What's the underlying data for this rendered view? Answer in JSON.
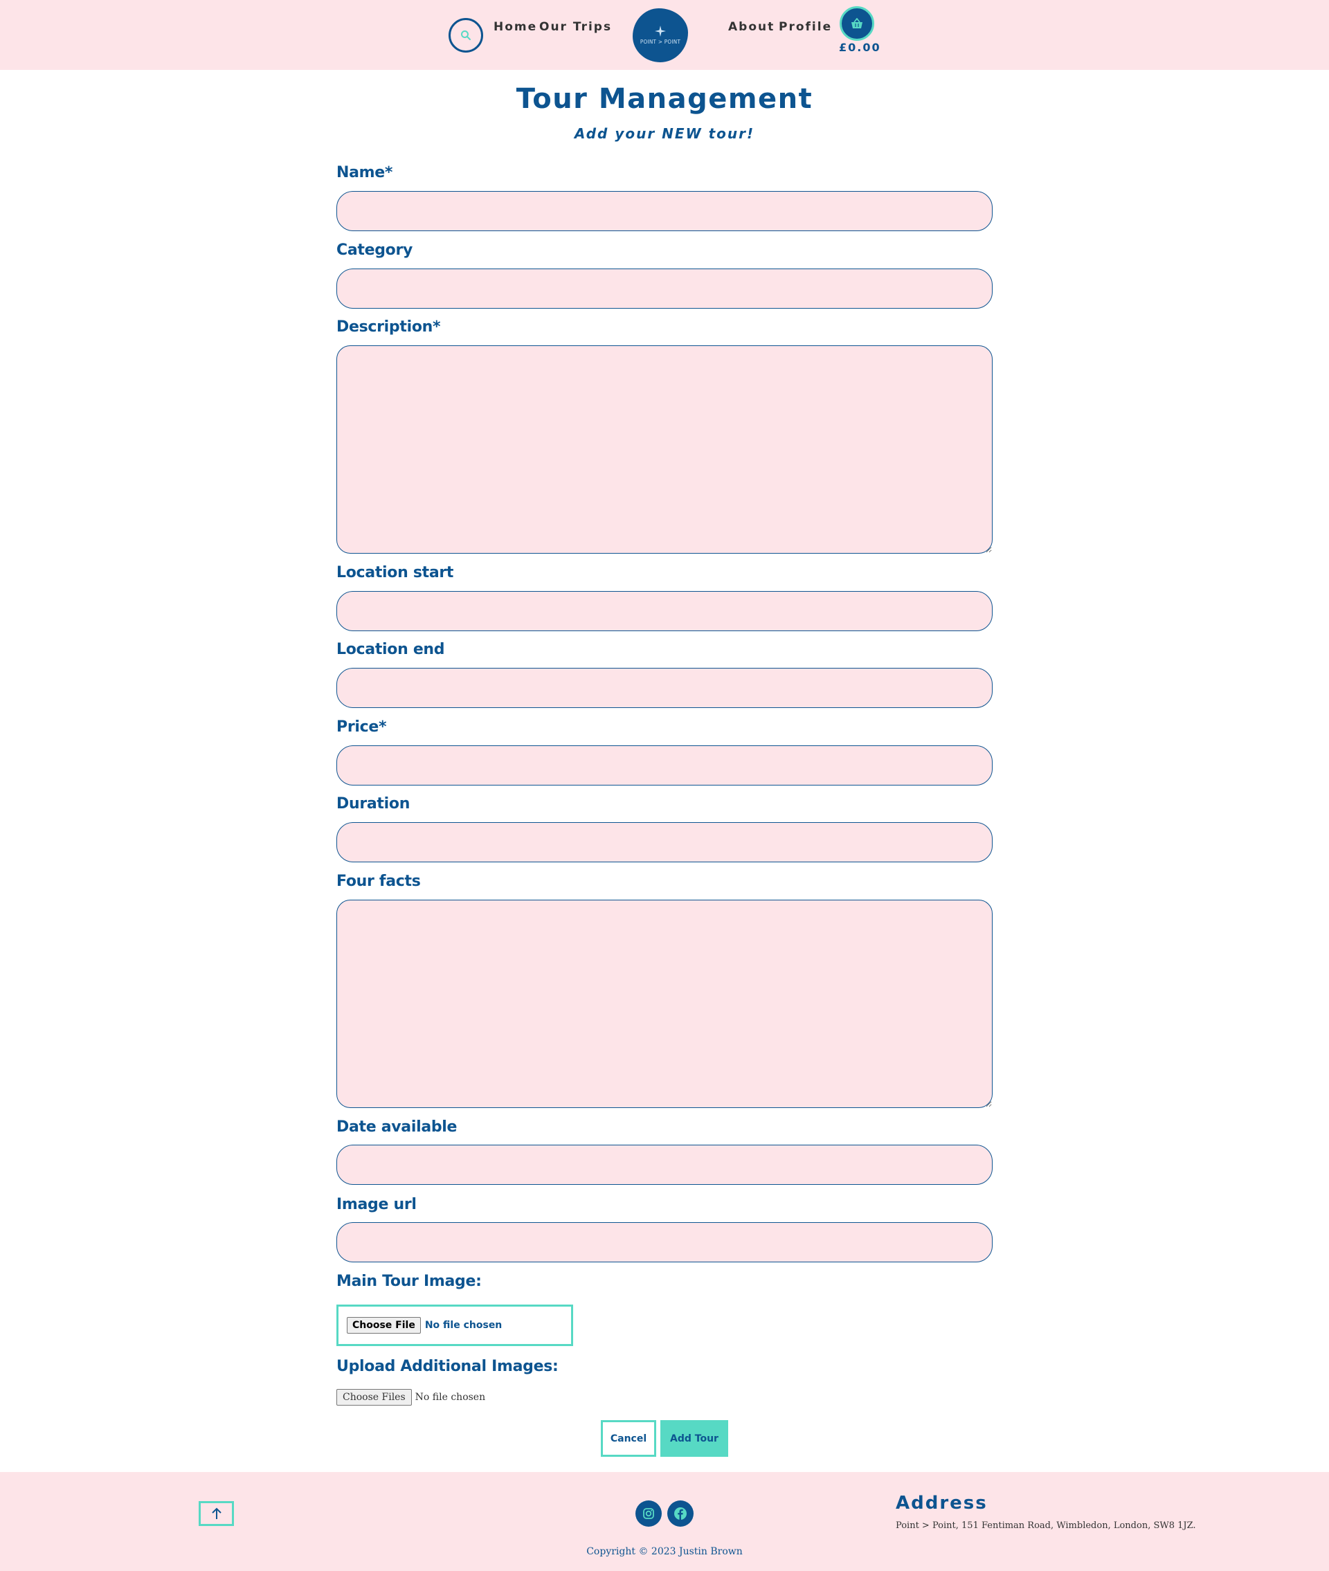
{
  "header": {
    "nav_left": [
      "Home",
      "Our Trips"
    ],
    "logo_text": "POINT > POINT",
    "nav_right": [
      "About",
      "Profile"
    ],
    "basket_total": "£0.00"
  },
  "page": {
    "title": "Tour Management",
    "subtitle": "Add your NEW tour!"
  },
  "form": {
    "name_label": "Name*",
    "category_label": "Category",
    "description_label": "Description*",
    "location_start_label": "Location start",
    "location_end_label": "Location end",
    "price_label": "Price*",
    "duration_label": "Duration",
    "four_facts_label": "Four facts",
    "date_available_label": "Date available",
    "image_url_label": "Image url",
    "main_image_label": "Main Tour Image:",
    "main_image_button": "Choose File",
    "main_image_status": "No file chosen",
    "additional_images_label": "Upload Additional Images:",
    "additional_images_button": "Choose Files",
    "additional_images_status": "No file chosen",
    "cancel_label": "Cancel",
    "submit_label": "Add Tour"
  },
  "footer": {
    "address_heading": "Address",
    "address_text": "Point > Point, 151 Fentiman Road, Wimbledon, London, SW8 1JZ.",
    "copyright": "Copyright © 2023 Justin Brown"
  },
  "colors": {
    "brand_blue": "#0d5490",
    "accent_teal": "#57d9c4",
    "pink_bg": "#fde4e8"
  }
}
